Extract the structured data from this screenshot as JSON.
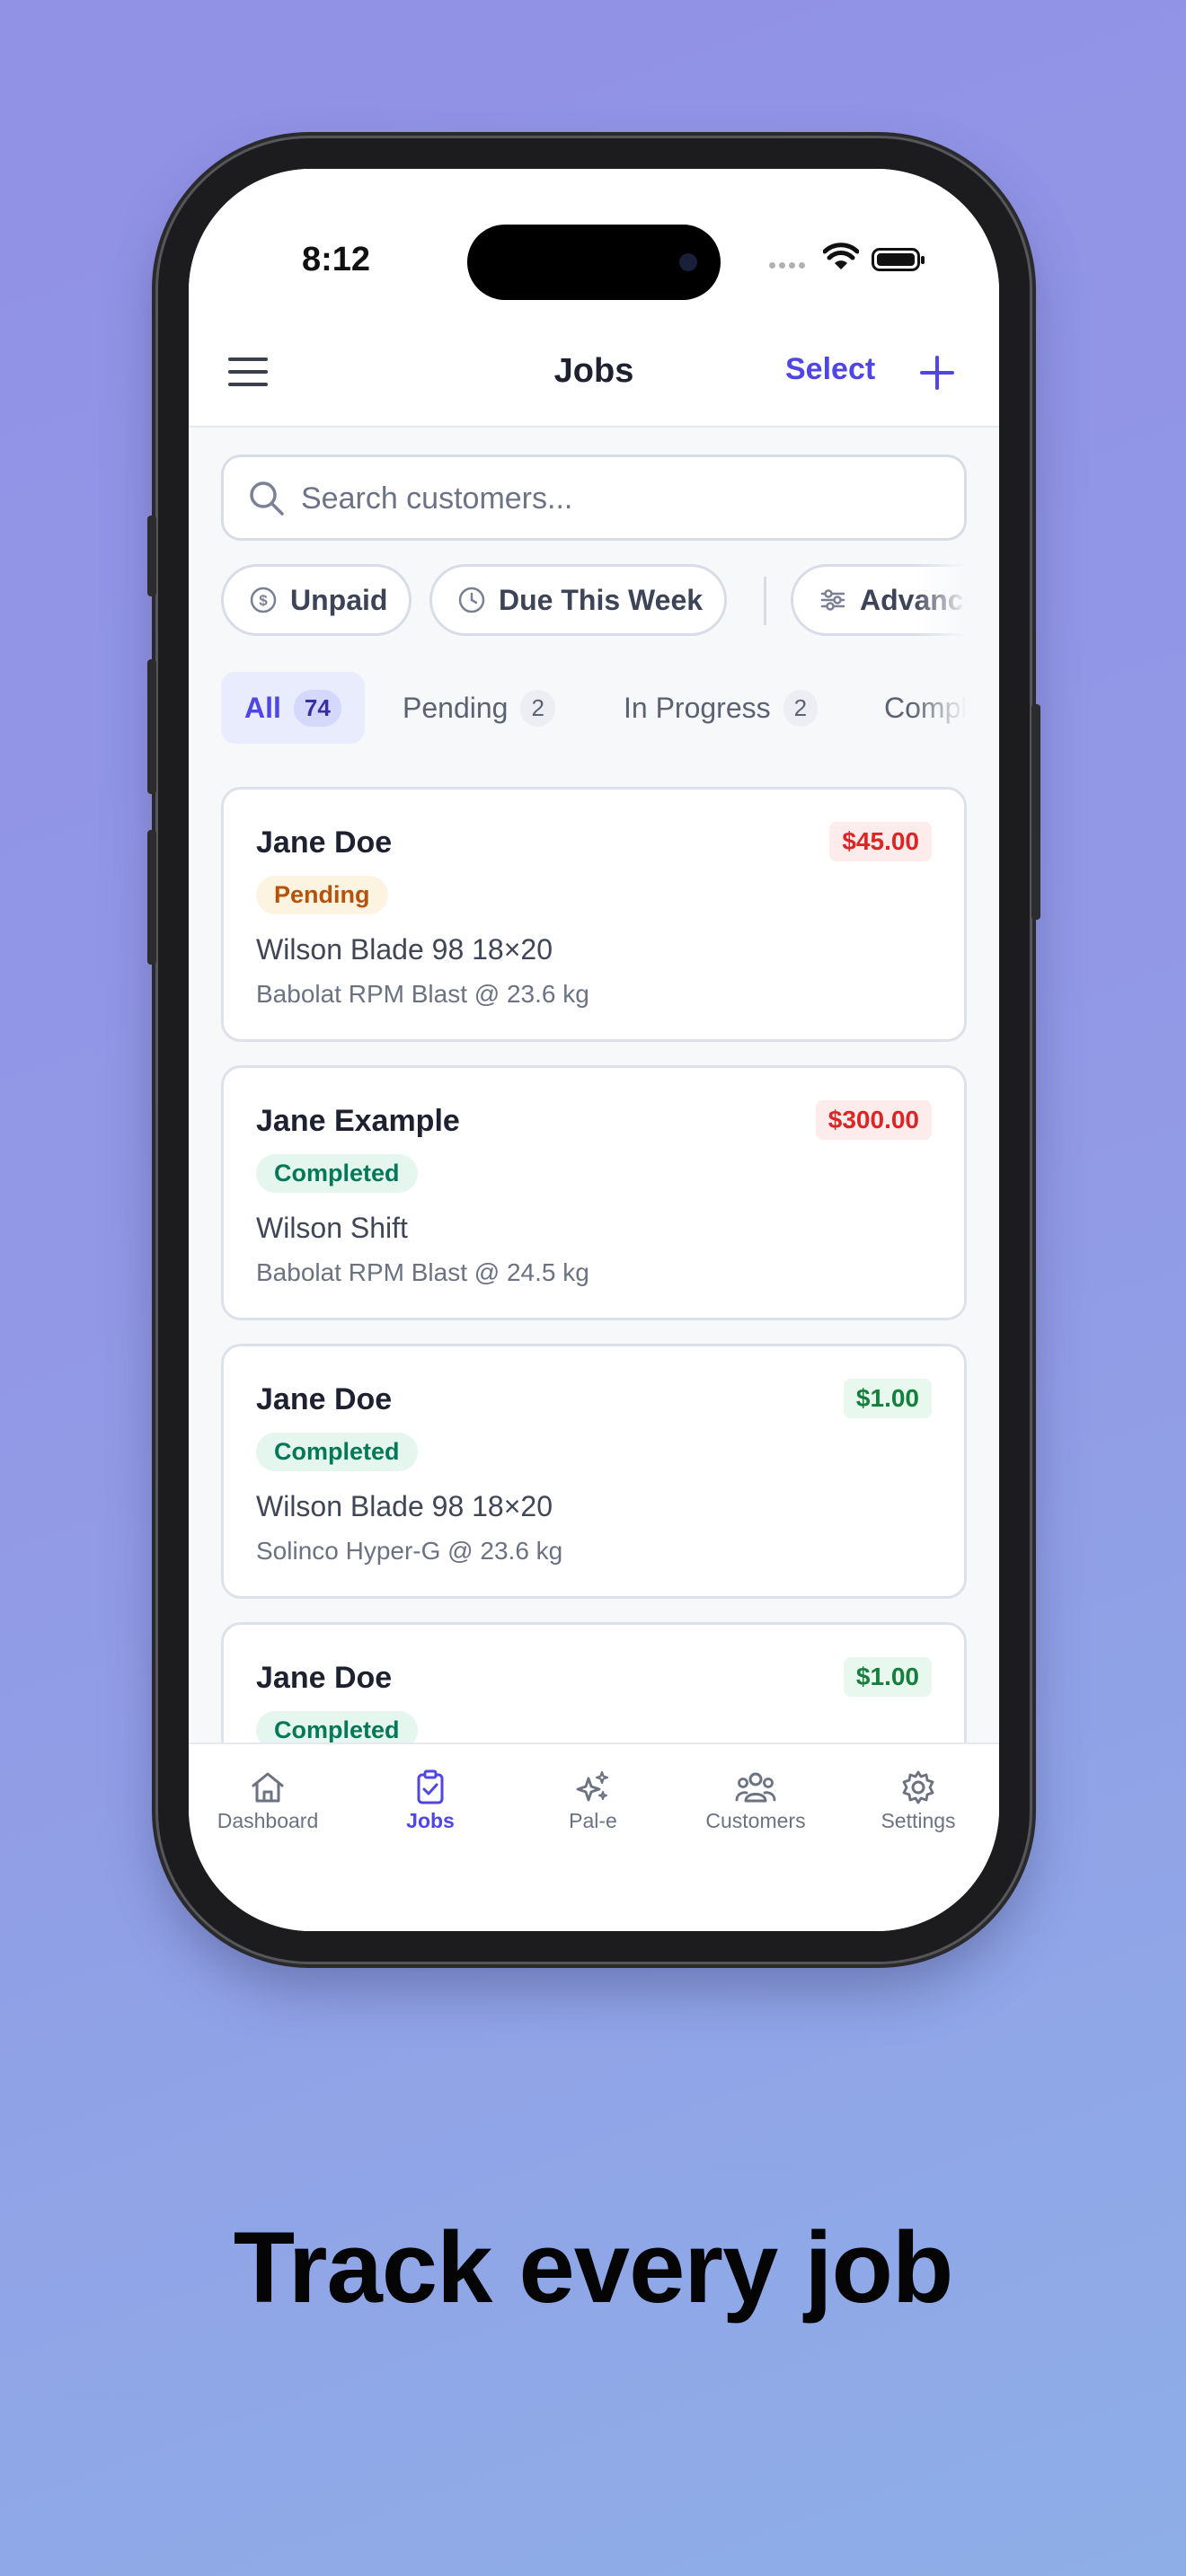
{
  "status_bar": {
    "time": "8:12"
  },
  "header": {
    "title": "Jobs",
    "select_label": "Select"
  },
  "search": {
    "placeholder": "Search customers..."
  },
  "filters": [
    {
      "label": "Unpaid",
      "icon": "dollar-circle-icon"
    },
    {
      "label": "Due This Week",
      "icon": "clock-icon"
    },
    {
      "label": "Advanced",
      "icon": "sliders-icon"
    }
  ],
  "tabs": [
    {
      "label": "All",
      "count": "74",
      "active": true
    },
    {
      "label": "Pending",
      "count": "2"
    },
    {
      "label": "In Progress",
      "count": "2"
    },
    {
      "label": "Completed",
      "count": ""
    }
  ],
  "jobs": [
    {
      "customer": "Jane Doe",
      "price": "$45.00",
      "paid": false,
      "status": "Pending",
      "racket": "Wilson Blade 98 18×20",
      "string": "Babolat RPM Blast @ 23.6 kg"
    },
    {
      "customer": "Jane Example",
      "price": "$300.00",
      "paid": false,
      "status": "Completed",
      "racket": "Wilson Shift",
      "string": "Babolat RPM Blast @ 24.5 kg"
    },
    {
      "customer": "Jane Doe",
      "price": "$1.00",
      "paid": true,
      "status": "Completed",
      "racket": "Wilson Blade 98 18×20",
      "string": "Solinco Hyper-G @ 23.6 kg"
    },
    {
      "customer": "Jane Doe",
      "price": "$1.00",
      "paid": true,
      "status": "Completed",
      "racket": "",
      "string": ""
    }
  ],
  "tab_bar": [
    {
      "label": "Dashboard",
      "icon": "home-icon"
    },
    {
      "label": "Jobs",
      "icon": "clipboard-check-icon",
      "active": true
    },
    {
      "label": "Pal-e",
      "icon": "sparkles-icon"
    },
    {
      "label": "Customers",
      "icon": "users-icon"
    },
    {
      "label": "Settings",
      "icon": "gear-icon"
    }
  ],
  "caption": "Track every job",
  "colors": {
    "accent": "#4f46e5",
    "unpaid": "#dc2626",
    "paid": "#15803d",
    "pending": "#b45309",
    "completed": "#047857"
  }
}
